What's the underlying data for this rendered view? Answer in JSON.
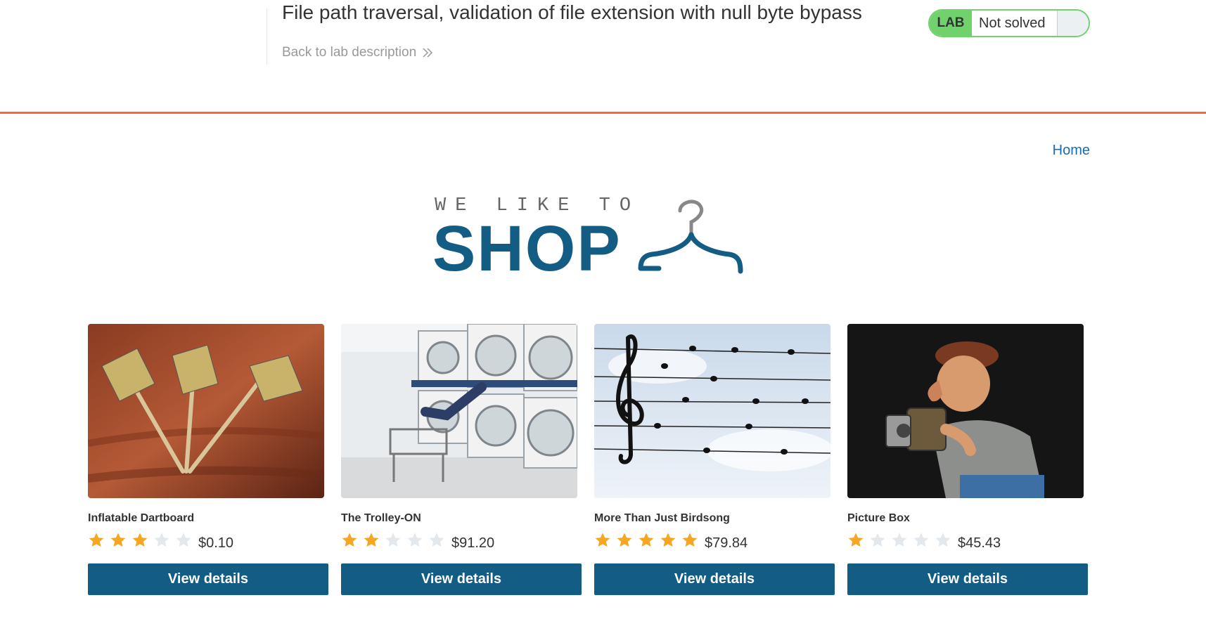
{
  "lab": {
    "title": "File path traversal, validation of file extension with null byte bypass",
    "back_link": "Back to lab description",
    "badge": "LAB",
    "status": "Not solved",
    "status_color": "#70d16d",
    "accent": "#ff6633"
  },
  "nav": {
    "home": "Home"
  },
  "logo": {
    "tagline": "WE LIKE TO",
    "name": "SHOP",
    "icon": "hanger-icon",
    "color": "#135d84"
  },
  "products": [
    {
      "name": "Inflatable Dartboard",
      "rating": 3,
      "max_rating": 5,
      "price": "$0.10",
      "button": "View details",
      "image": "darts-image"
    },
    {
      "name": "The Trolley-ON",
      "rating": 2,
      "max_rating": 5,
      "price": "$91.20",
      "button": "View details",
      "image": "laundromat-image"
    },
    {
      "name": "More Than Just Birdsong",
      "rating": 5,
      "max_rating": 5,
      "price": "$79.84",
      "button": "View details",
      "image": "birds-on-wires-image"
    },
    {
      "name": "Picture Box",
      "rating": 1,
      "max_rating": 5,
      "price": "$45.43",
      "button": "View details",
      "image": "photographer-figurine-image"
    }
  ]
}
